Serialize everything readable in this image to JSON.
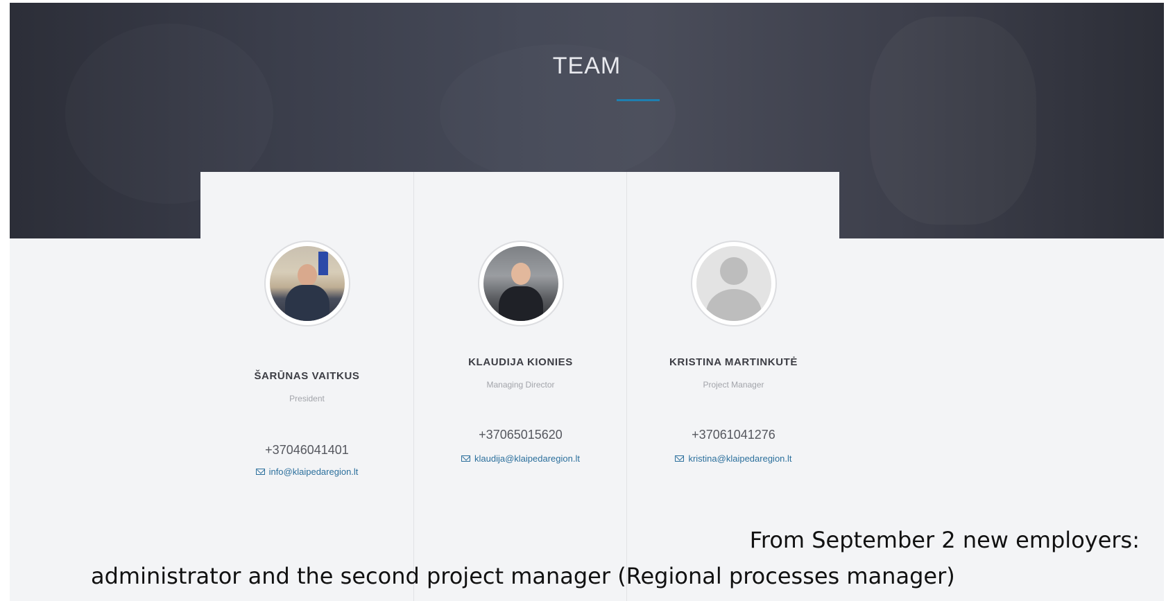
{
  "hero": {
    "title": "TEAM",
    "accent_color": "#1e7fb0"
  },
  "team": {
    "members": [
      {
        "name": "ŠARŪNAS VAITKUS",
        "role": "President",
        "phone": "+37046041401",
        "email": "info@klaipedaregion.lt",
        "avatar": "photo"
      },
      {
        "name": "KLAUDIJA KIONIES",
        "role": "Managing Director",
        "phone": "+37065015620",
        "email": "klaudija@klaipedaregion.lt",
        "avatar": "photo"
      },
      {
        "name": "KRISTINA MARTINKUTĖ",
        "role": "Project Manager",
        "phone": "+37061041276",
        "email": "kristina@klaipedaregion.lt",
        "avatar": "placeholder-silhouette"
      }
    ]
  },
  "note": {
    "line1": "From September 2 new employers:",
    "line2": "administrator and the second project manager (Regional processes manager)"
  },
  "colors": {
    "name_text": "#3c3d44",
    "role_text": "#a2a4aa",
    "email_link": "#2b6f9c",
    "panel_bg": "#f3f4f6"
  }
}
